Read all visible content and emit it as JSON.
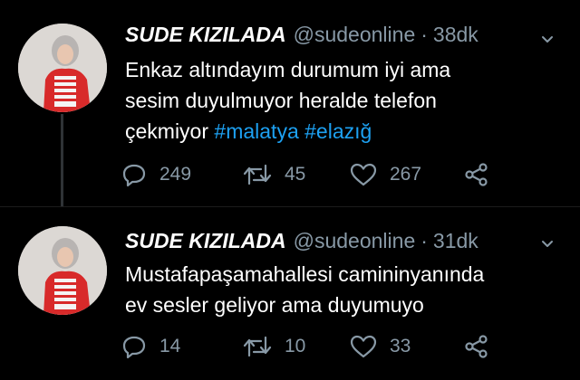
{
  "tweets": [
    {
      "display_name": "SUDE KIZILADA",
      "handle": "@sudeonline",
      "separator": "·",
      "time": "38dk",
      "text_lines": [
        "Enkaz altındayım durumum iyi ama",
        "sesim duyulmuyor heralde telefon",
        "çekmiyor "
      ],
      "hashtags": [
        "#malatya",
        "#elazığ"
      ],
      "replies": "249",
      "retweets": "45",
      "likes": "267"
    },
    {
      "display_name": "SUDE KIZILADA",
      "handle": "@sudeonline",
      "separator": "·",
      "time": "31dk",
      "text_lines": [
        "Mustafapaşamahallesi camininyanında",
        "ev sesler geliyor ama duyumuyo"
      ],
      "replies": "14",
      "retweets": "10",
      "likes": "33"
    }
  ],
  "icons": {
    "reply": "reply-icon",
    "retweet": "retweet-icon",
    "like": "heart-icon",
    "share": "share-icon",
    "menu": "chevron-down-icon"
  },
  "colors": {
    "background": "#000000",
    "text": "#ffffff",
    "muted": "#8899a6",
    "hashtag": "#1da1f2"
  }
}
